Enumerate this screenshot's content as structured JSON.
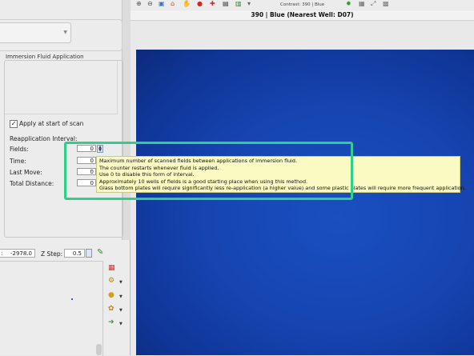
{
  "toolbar": {
    "contrast_label": "Contrast: 390 | Blue",
    "icons": [
      "zoom-in-icon",
      "zoom-out-icon",
      "fit-icon",
      "home-icon",
      "hand-icon",
      "stop-icon",
      "crosshair-icon",
      "camera-icon",
      "printer-icon",
      "save-icon",
      "settings-icon",
      "histogram-icon",
      "export-icon",
      "gallery-icon"
    ]
  },
  "image_title": "390 | Blue (Nearest Well: D07)",
  "panel": {
    "immersion_title": "Immersion Fluid Application",
    "apply_label": "Apply at start of scan",
    "apply_checked": "✓",
    "reapplication_label": "Reapplication Interval:",
    "fields_label": "Fields:",
    "fields_value": "0",
    "time_label": "Time:",
    "time_value": "0",
    "last_move_label": "Last Move:",
    "last_move_value": "0",
    "total_distance_label": "Total Distance:",
    "total_distance_value": "0"
  },
  "tooltip": {
    "lines": [
      "Maximum number of scanned fields between applications of immersion fluid.",
      "The counter restarts whenever fluid is applied.",
      "Use 0 to disable this form of interval.",
      "Approximately 10 wells of fields is a good starting place when using this method.",
      "Glass bottom plates will require significantly less re-application (a higher value) and some plastic plates will require more frequent application."
    ]
  },
  "zcontrols": {
    "z_value": "-2978.0",
    "zstep_label": "Z Step:",
    "zstep_value": "0.5"
  },
  "colors": {
    "highlight": "#2fcf8a",
    "tooltip_bg": "#fafac2",
    "image_blue": "#1645b2"
  }
}
